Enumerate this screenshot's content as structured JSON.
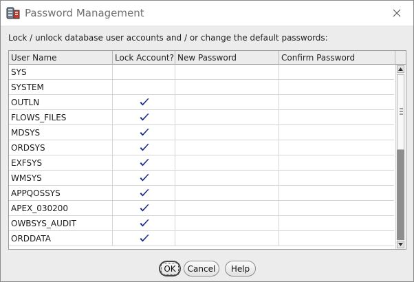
{
  "window": {
    "title": "Password Management",
    "icon": "database-config-icon",
    "close_icon": "close-icon"
  },
  "instructions": "Lock / unlock database user accounts and / or change the default passwords:",
  "table": {
    "columns": [
      "User Name",
      "Lock Account?",
      "New Password",
      "Confirm Password"
    ],
    "rows": [
      {
        "user": "SYS",
        "locked": false
      },
      {
        "user": "SYSTEM",
        "locked": false
      },
      {
        "user": "OUTLN",
        "locked": true
      },
      {
        "user": "FLOWS_FILES",
        "locked": true
      },
      {
        "user": "MDSYS",
        "locked": true
      },
      {
        "user": "ORDSYS",
        "locked": true
      },
      {
        "user": "EXFSYS",
        "locked": true
      },
      {
        "user": "WMSYS",
        "locked": true
      },
      {
        "user": "APPQOSSYS",
        "locked": true
      },
      {
        "user": "APEX_030200",
        "locked": true
      },
      {
        "user": "OWBSYS_AUDIT",
        "locked": true
      },
      {
        "user": "ORDDATA",
        "locked": true
      }
    ],
    "check_color": "#1a2a8c"
  },
  "buttons": {
    "ok_label": "OK",
    "cancel_label": "Cancel",
    "help_label": "Help"
  }
}
